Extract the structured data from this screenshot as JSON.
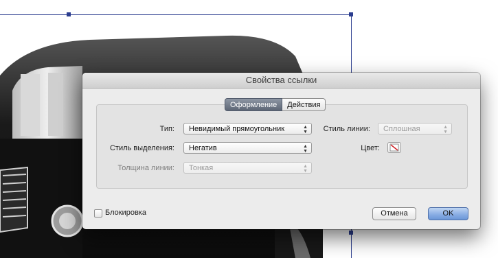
{
  "dialog": {
    "title": "Свойства ссылки",
    "tabs": [
      {
        "label": "Оформление",
        "active": true
      },
      {
        "label": "Действия",
        "active": false
      }
    ],
    "fields": {
      "type": {
        "label": "Тип:",
        "value": "Невидимый прямоугольник"
      },
      "highlight": {
        "label": "Стиль выделения:",
        "value": "Негатив"
      },
      "thickness": {
        "label": "Толщина линии:",
        "value": "Тонкая",
        "disabled": true
      },
      "line_style": {
        "label": "Стиль линии:",
        "value": "Сплошная",
        "disabled": true
      },
      "color": {
        "label": "Цвет:",
        "icon": "no-color-swatch-icon"
      }
    },
    "lock_label": "Блокировка",
    "lock_checked": false,
    "cancel_label": "Отмена",
    "ok_label": "OK"
  },
  "colors": {
    "frame": "#2b3d8f",
    "dialog_bg": "#ececec",
    "ok_button": "#7ea3e0",
    "active_tab": "#6e7786"
  },
  "background": {
    "image": "black-and-white-vintage-car-photo"
  }
}
